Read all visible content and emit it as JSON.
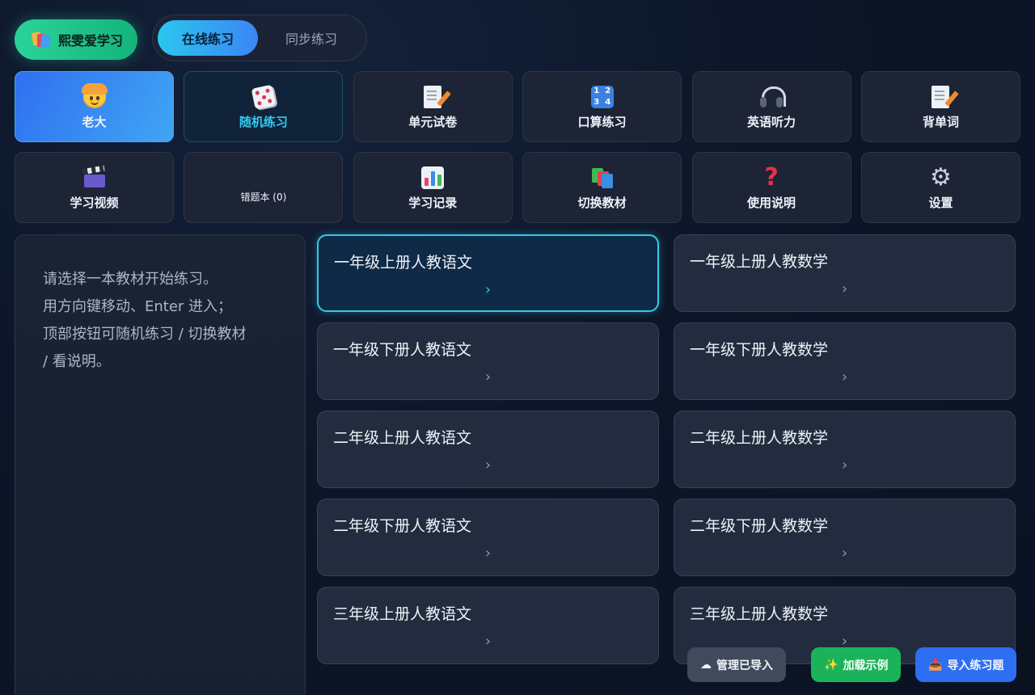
{
  "topbar": {
    "brand_label": "熙雯爱学习",
    "tabs": [
      {
        "label": "在线练习",
        "active": true
      },
      {
        "label": "同步练习",
        "active": false
      }
    ]
  },
  "tiles": [
    {
      "label": "老大",
      "icon": "child-face-icon"
    },
    {
      "label": "随机练习",
      "icon": "dice-icon"
    },
    {
      "label": "单元试卷",
      "icon": "memo-icon"
    },
    {
      "label": "口算练习",
      "icon": "number-pad-icon",
      "digits": [
        "1",
        "2",
        "3",
        "4"
      ]
    },
    {
      "label": "英语听力",
      "icon": "headphones-icon"
    },
    {
      "label": "背单词",
      "icon": "memo-icon"
    },
    {
      "label": "学习视频",
      "icon": "clapper-icon"
    },
    {
      "label": "错题本 (0)",
      "icon": "none"
    },
    {
      "label": "学习记录",
      "icon": "bar-chart-icon"
    },
    {
      "label": "切换教材",
      "icon": "books-icon"
    },
    {
      "label": "使用说明",
      "icon": "question-mark-icon"
    },
    {
      "label": "设置",
      "icon": "gear-icon"
    }
  ],
  "info": {
    "lines": [
      "请选择一本教材开始练习。",
      "用方向键移动、Enter 进入；",
      "顶部按钮可随机练习 / 切换教材",
      "/ 看说明。"
    ]
  },
  "cards": [
    {
      "title": "一年级上册人教语文",
      "chevron": "›"
    },
    {
      "title": "一年级上册人教数学",
      "chevron": "›"
    },
    {
      "title": "一年级下册人教语文",
      "chevron": "›"
    },
    {
      "title": "一年级下册人教数学",
      "chevron": "›"
    },
    {
      "title": "二年级上册人教语文",
      "chevron": "›"
    },
    {
      "title": "二年级上册人教数学",
      "chevron": "›"
    },
    {
      "title": "二年级下册人教语文",
      "chevron": "›"
    },
    {
      "title": "二年级下册人教数学",
      "chevron": "›"
    },
    {
      "title": "三年级上册人教语文",
      "chevron": "›"
    },
    {
      "title": "三年级上册人教数学",
      "chevron": "›"
    }
  ],
  "selected_card": 0,
  "buttons": {
    "manage": {
      "icon": "☁",
      "label": "管理已导入"
    },
    "sample": {
      "icon": "✨",
      "label": "加载示例"
    },
    "import": {
      "icon": "📥",
      "label": "导入练习题"
    }
  },
  "colors": {
    "accent_cyan": "#35c8e6",
    "brand_green": "#2bd39a",
    "import_blue": "#2d6ef2",
    "sample_green": "#1bb35a"
  }
}
